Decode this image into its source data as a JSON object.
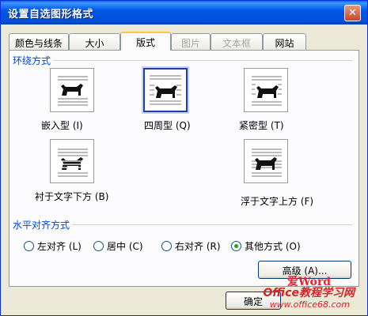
{
  "window": {
    "title": "设置自选图形格式",
    "close_symbol": "✕"
  },
  "tabs": [
    {
      "label": "颜色与线条",
      "state": "normal"
    },
    {
      "label": "大小",
      "state": "normal"
    },
    {
      "label": "版式",
      "state": "active"
    },
    {
      "label": "图片",
      "state": "disabled"
    },
    {
      "label": "文本框",
      "state": "disabled"
    },
    {
      "label": "网站",
      "state": "normal"
    }
  ],
  "wrapping": {
    "section_title": "环绕方式",
    "options": [
      {
        "label": "嵌入型 (I)",
        "icon": "inline-with-text-icon",
        "selected": false
      },
      {
        "label": "四周型 (Q)",
        "icon": "square-wrap-icon",
        "selected": true
      },
      {
        "label": "紧密型 (T)",
        "icon": "tight-wrap-icon",
        "selected": false
      },
      {
        "label": "衬于文字下方 (B)",
        "icon": "behind-text-icon",
        "selected": false
      },
      {
        "label": "浮于文字上方 (F)",
        "icon": "in-front-of-text-icon",
        "selected": false
      }
    ]
  },
  "alignment": {
    "section_title": "水平对齐方式",
    "options": [
      {
        "label": "左对齐 (L)",
        "selected": false
      },
      {
        "label": "居中 (C)",
        "selected": false
      },
      {
        "label": "右对齐 (R)",
        "selected": false
      },
      {
        "label": "其他方式 (O)",
        "selected": true
      }
    ]
  },
  "buttons": {
    "advanced": "高级 (A)...",
    "ok": "确定"
  },
  "watermark": {
    "top": "爱Word",
    "middle": "Office教程学习网",
    "bottom": "www.office68.com"
  },
  "colors": {
    "title_bar": "#0058e6",
    "selected_tab_highlight": "#ffc83c",
    "section_title": "#0046d5",
    "watermark": "#d8232a"
  }
}
